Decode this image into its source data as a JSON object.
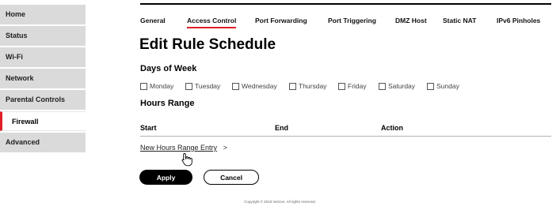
{
  "sidebar": {
    "items": [
      {
        "label": "Home"
      },
      {
        "label": "Status"
      },
      {
        "label": "Wi-Fi"
      },
      {
        "label": "Network"
      },
      {
        "label": "Parental Controls"
      },
      {
        "label": "Firewall",
        "active": true
      },
      {
        "label": "Advanced"
      }
    ]
  },
  "tabs": [
    {
      "label": "General"
    },
    {
      "label": "Access Control",
      "active": true
    },
    {
      "label": "Port Forwarding"
    },
    {
      "label": "Port Triggering"
    },
    {
      "label": "DMZ Host"
    },
    {
      "label": "Static NAT"
    },
    {
      "label": "IPv6 Pinholes"
    }
  ],
  "page_title": "Edit Rule Schedule",
  "days_title": "Days of Week",
  "days": [
    "Monday",
    "Tuesday",
    "Wednesday",
    "Thursday",
    "Friday",
    "Saturday",
    "Sunday"
  ],
  "hours_title": "Hours Range",
  "table": {
    "headers": [
      "Start",
      "End",
      "Action"
    ]
  },
  "new_entry_link": "New Hours Range Entry",
  "new_entry_chevron": ">",
  "buttons": {
    "apply": "Apply",
    "cancel": "Cancel"
  },
  "footer": "Copyright © 2019 Verizon. All rights reserved.",
  "colors": {
    "accent": "#e01f26",
    "sidebar_bg": "#dadada"
  }
}
